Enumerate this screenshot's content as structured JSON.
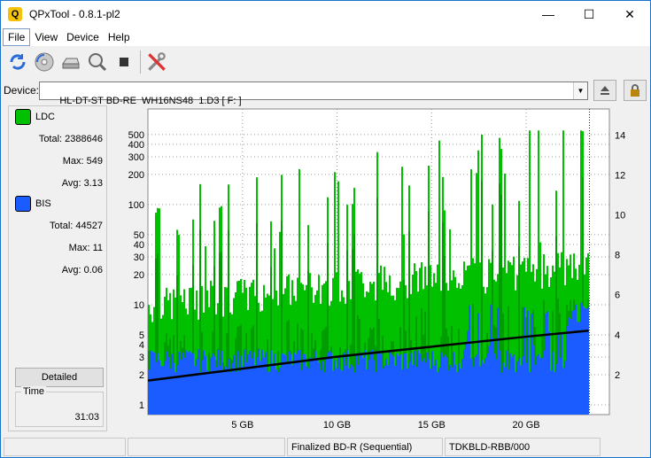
{
  "window": {
    "title": "QPxTool - 0.8.1-pl2",
    "app_icon_letter": "Q",
    "minimize_glyph": "—",
    "maximize_glyph": "☐",
    "close_glyph": "✕"
  },
  "menu": [
    "File",
    "View",
    "Device",
    "Help"
  ],
  "toolbar": {
    "icons": [
      "refresh-icon",
      "disc-scan-icon",
      "drive-icon",
      "zoom-icon",
      "stop-icon",
      "tools-icon"
    ]
  },
  "device": {
    "label": "Device:",
    "value": "HL-DT-ST BD-RE  WH16NS48  1.D3 [ F: ]"
  },
  "left_panel": {
    "ldc": {
      "name": "LDC",
      "color": "#00c000",
      "total_label": "Total:",
      "total": "2388646",
      "max_label": "Max:",
      "max": "549",
      "avg_label": "Avg:",
      "avg": "3.13"
    },
    "bis": {
      "name": "BIS",
      "color": "#1a5cff",
      "total_label": "Total:",
      "total": "44527",
      "max_label": "Max:",
      "max": "11",
      "avg_label": "Avg:",
      "avg": "0.06"
    },
    "detailed_button": "Detailed",
    "time_label": "Time",
    "time_value": "31:03"
  },
  "status_bar": {
    "cell1": "",
    "cell2": "",
    "media": "Finalized BD-R (Sequential)",
    "media_id": "TDKBLD-RBB/000"
  },
  "chart_data": {
    "type": "area",
    "x_ticks": [
      "5 GB",
      "10 GB",
      "15 GB",
      "20 GB"
    ],
    "x_tick_values": [
      5,
      10,
      15,
      20
    ],
    "xlim": [
      0,
      24.4
    ],
    "data_end": 23.3,
    "y_left_scale": "log",
    "y_left_ticks": [
      "1",
      "2",
      "3",
      "4",
      "5",
      "10",
      "20",
      "30",
      "40",
      "50",
      "100",
      "200",
      "300",
      "400",
      "500"
    ],
    "y_left_tick_values": [
      1,
      2,
      3,
      4,
      5,
      10,
      20,
      30,
      40,
      50,
      100,
      200,
      300,
      400,
      500
    ],
    "ylim_left": [
      0.8,
      900
    ],
    "y_right_ticks": [
      "2",
      "4",
      "6",
      "8",
      "10",
      "12",
      "14"
    ],
    "y_right_tick_values": [
      2,
      4,
      6,
      8,
      10,
      12,
      14
    ],
    "ylim_right": [
      0,
      15.3
    ],
    "grid": true,
    "series": [
      {
        "name": "LDC",
        "color": "#00c000",
        "baseline": 10,
        "max": 549
      },
      {
        "name": "BIS",
        "color": "#1a5cff",
        "baseline": 3,
        "max": 11
      },
      {
        "color": "#000000",
        "x": [
          0,
          5,
          10,
          15,
          20,
          23.3
        ],
        "y": [
          1.7,
          2.3,
          2.9,
          3.4,
          3.9,
          4.2
        ]
      }
    ]
  }
}
